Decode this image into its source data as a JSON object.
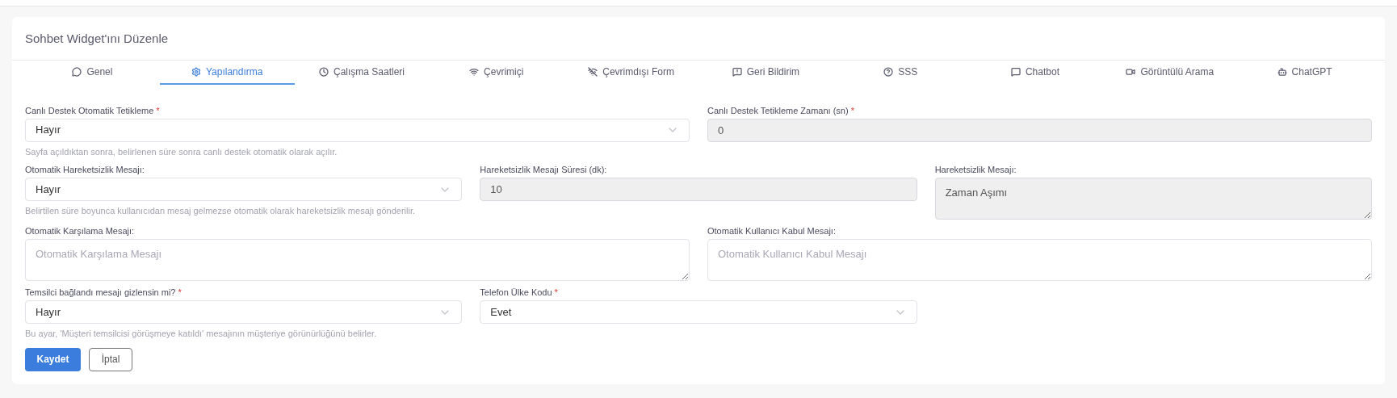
{
  "card": {
    "title": "Sohbet Widget'ını Düzenle"
  },
  "tabs": [
    {
      "label": "Genel",
      "selected": false
    },
    {
      "label": "Yapılandırma",
      "selected": true
    },
    {
      "label": "Çalışma Saatleri",
      "selected": false
    },
    {
      "label": "Çevrimiçi",
      "selected": false
    },
    {
      "label": "Çevrimdışı Form",
      "selected": false
    },
    {
      "label": "Geri Bildirim",
      "selected": false
    },
    {
      "label": "SSS",
      "selected": false
    },
    {
      "label": "Chatbot",
      "selected": false
    },
    {
      "label": "Görüntülü Arama",
      "selected": false
    },
    {
      "label": "ChatGPT",
      "selected": false
    }
  ],
  "rows": [
    {
      "fields": [
        {
          "kind": "select",
          "label": "Canlı Destek Otomatik Tetikleme",
          "required_mark": "*",
          "value": "Hayır",
          "help": "Sayfa açıldıktan sonra, belirlenen süre sonra canlı destek otomatik olarak açılır."
        },
        {
          "kind": "input",
          "label": "Canlı Destek Tetikleme Zamanı (sn)",
          "required_mark": "*",
          "value": "0",
          "disabled": true
        }
      ]
    },
    {
      "fields": [
        {
          "kind": "select",
          "label": "Otomatik Hareketsizlik Mesajı:",
          "value": "Hayır",
          "help": "Belirtilen süre boyunca kullanıcıdan mesaj gelmezse otomatik olarak hareketsizlik mesajı gönderilir."
        },
        {
          "kind": "input",
          "label": "Hareketsizlik Mesajı Süresi (dk):",
          "value": "10",
          "disabled": true
        },
        {
          "kind": "textarea",
          "label": "Hareketsizlik Mesajı:",
          "value": "Zaman Aşımı",
          "disabled": true
        }
      ]
    },
    {
      "fields": [
        {
          "kind": "textarea",
          "label": "Otomatik Karşılama Mesajı:",
          "placeholder": "Otomatik Karşılama Mesajı",
          "disabled": false
        },
        {
          "kind": "textarea",
          "label": "Otomatik Kullanıcı Kabul Mesajı:",
          "placeholder": "Otomatik Kullanıcı Kabul Mesajı",
          "disabled": false
        }
      ]
    },
    {
      "fields": [
        {
          "kind": "select",
          "label": "Temsilci bağlandı mesajı gizlensin mi?",
          "required_mark": "*",
          "value": "Hayır",
          "help": "Bu ayar, 'Müşteri temsilcisi görüşmeye katıldı' mesajının müşteriye görünürlüğünü belirler."
        },
        {
          "kind": "select",
          "label": "Telefon Ülke Kodu",
          "required_mark": "*",
          "value": "Evet"
        }
      ]
    }
  ],
  "buttons": [
    {
      "label": "Kaydet",
      "kind": "primary"
    },
    {
      "label": "İptal",
      "kind": "secondary"
    }
  ]
}
